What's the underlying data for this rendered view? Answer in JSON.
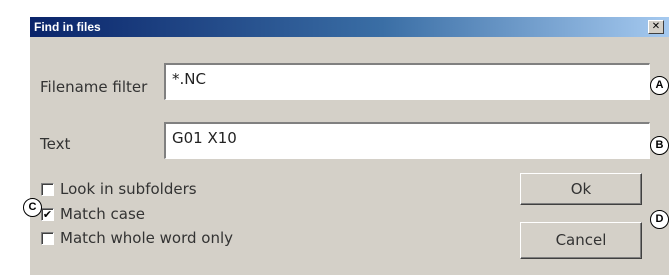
{
  "window": {
    "title": "Find in files",
    "close_glyph": "✕"
  },
  "form": {
    "filename_label": "Filename filter",
    "filename_value": "*.NC",
    "text_label": "Text",
    "text_value": "G01 X10"
  },
  "options": {
    "look_subfolders": {
      "label": "Look in subfolders",
      "checked": false
    },
    "match_case": {
      "label": "Match case",
      "checked": true,
      "check_glyph": "✔"
    },
    "match_whole_word": {
      "label": "Match whole word only",
      "checked": false
    }
  },
  "buttons": {
    "ok": "Ok",
    "cancel": "Cancel"
  },
  "callouts": {
    "a": "A",
    "b": "B",
    "c": "C",
    "d": "D"
  }
}
